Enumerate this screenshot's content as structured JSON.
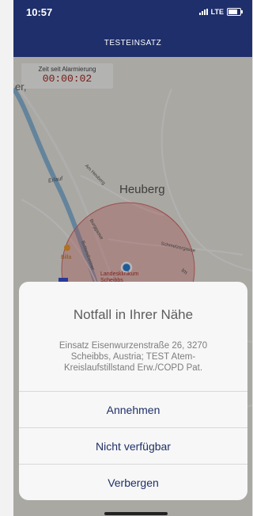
{
  "status_bar": {
    "time": "10:57",
    "carrier": "LTE"
  },
  "header": {
    "title": "TESTEINSATZ"
  },
  "timer": {
    "label": "Zeit seit Alarmierung",
    "value": "00:00:02"
  },
  "map": {
    "labels": {
      "town": "Heuberg",
      "erlauf": "Erlauf",
      "street_heuberg": "Am Heuberg",
      "street_schmeizer": "Schmelzergasse",
      "street_burg": "Burggasse",
      "street_butterstr": "Butterstheimer",
      "billa": "Billa",
      "hospital": "Landesklinikum Scheibbs",
      "left_edge": "er,",
      "im": "Im"
    }
  },
  "alert": {
    "title": "Notfall in Ihrer Nähe",
    "message": "Einsatz Eisenwurzenstraße 26, 3270 Scheibbs, Austria; TEST Atem-Kreislaufstillstand Erw./COPD Pat.",
    "buttons": [
      "Annehmen",
      "Nicht verfügbar",
      "Verbergen"
    ]
  },
  "colors": {
    "header": "#1f2f6b",
    "accent": "#1e3067",
    "radius": "#e36b6b",
    "location": "#2a7fd4"
  }
}
